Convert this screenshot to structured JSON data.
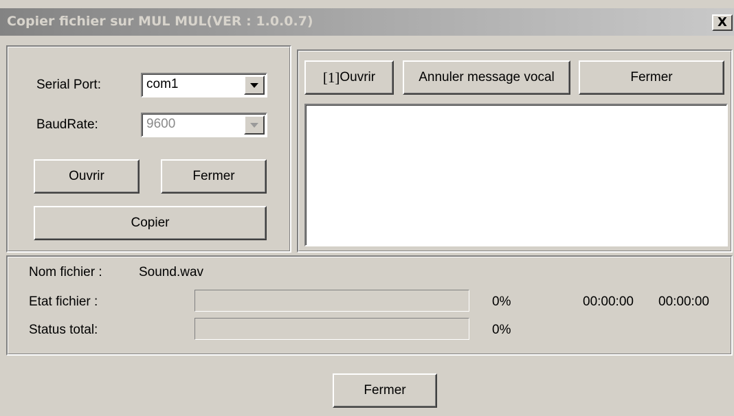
{
  "window": {
    "title": "Copier fichier sur MUL MUL(VER : 1.0.0.7)",
    "close_glyph": "X"
  },
  "serial": {
    "port_label": "Serial Port:",
    "port_value": "com1",
    "baud_label": "BaudRate:",
    "baud_value": "9600",
    "open_label": "Ouvrir",
    "close_label": "Fermer",
    "copy_label": "Copier"
  },
  "voice": {
    "open_prefix": "[1]",
    "open_label": "Ouvrir",
    "cancel_label": "Annuler message vocal",
    "close_label": "Fermer",
    "log_text": ""
  },
  "status": {
    "filename_label": "Nom fichier :",
    "filename_value": "Sound.wav",
    "file_state_label": "Etat fichier :",
    "file_percent": "0%",
    "file_progress": 0,
    "elapsed": "00:00:00",
    "remaining": "00:00:00",
    "total_label": "Status total:",
    "total_percent": "0%",
    "total_progress": 0
  },
  "footer": {
    "close_label": "Fermer"
  },
  "colors": {
    "face": "#d4d0c8",
    "title_start": "#838383",
    "title_end": "#c9c9c9",
    "title_text": "#d8d4cc"
  },
  "icons": {
    "close": "close-icon",
    "dropdown": "chevron-down-icon"
  }
}
